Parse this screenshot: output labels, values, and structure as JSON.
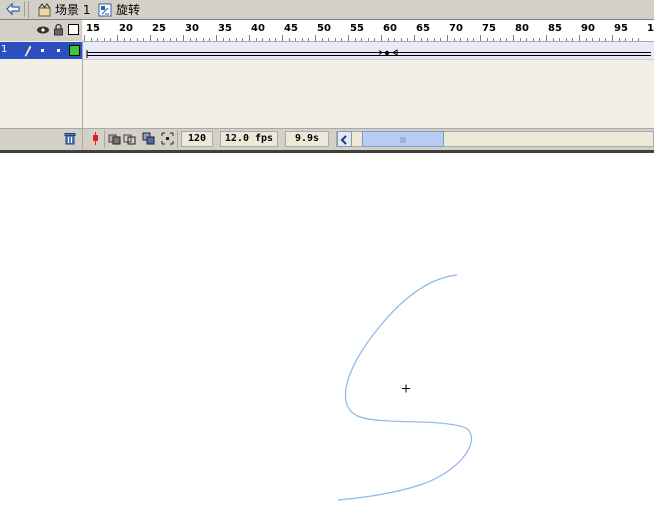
{
  "breadcrumb": {
    "scene_label": "场景 1",
    "symbol_label": "旋转"
  },
  "timeline": {
    "ruler_ticks": [
      "15",
      "20",
      "25",
      "30",
      "35",
      "40",
      "45",
      "50",
      "55",
      "60",
      "65",
      "70",
      "75",
      "80",
      "85",
      "90",
      "95",
      "1"
    ],
    "layer_number": "1",
    "status": {
      "current_frame": "120",
      "frame_rate": "12.0 fps",
      "elapsed_time": "9.9s"
    }
  },
  "icons": {
    "back": "back-arrow-icon",
    "scene": "scene-icon",
    "symbol": "symbol-icon",
    "eye": "eye-icon",
    "lock": "lock-icon",
    "outline": "outline-icon",
    "pencil": "pencil-icon",
    "trash": "trash-icon",
    "playhead": "center-frame-icon",
    "onion": "onion-skin-icon",
    "onion_outline": "onion-outline-icon",
    "edit_multiple": "edit-multiple-frames-icon",
    "modify_markers": "modify-markers-icon"
  },
  "colors": {
    "layer_selected": "#2b4fbd",
    "layer_outline": "#33cc33",
    "stroke": "#8fb6e8",
    "playhead": "#e02020"
  }
}
